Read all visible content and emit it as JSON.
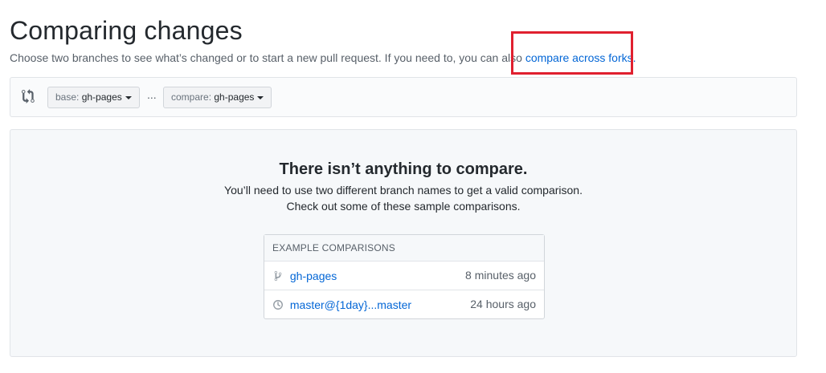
{
  "header": {
    "title": "Comparing changes",
    "subtitle_text": "Choose two branches to see what’s changed or to start a new pull request. If you need to, you can also ",
    "forks_link": "compare across forks."
  },
  "range": {
    "base_label": "base:",
    "base_value": "gh-pages",
    "separator": "...",
    "compare_label": "compare:",
    "compare_value": "gh-pages"
  },
  "blankslate": {
    "heading": "There isn’t anything to compare.",
    "line1": "You’ll need to use two different branch names to get a valid comparison.",
    "line2": "Check out some of these sample comparisons."
  },
  "examples": {
    "header": "EXAMPLE COMPARISONS",
    "rows": [
      {
        "icon": "branch-icon",
        "label": "gh-pages",
        "time": "8 minutes ago"
      },
      {
        "icon": "history-icon",
        "label": "master@{1day}...master",
        "time": "24 hours ago"
      }
    ]
  },
  "colors": {
    "link": "#0366d6",
    "highlight": "#e0202f"
  }
}
